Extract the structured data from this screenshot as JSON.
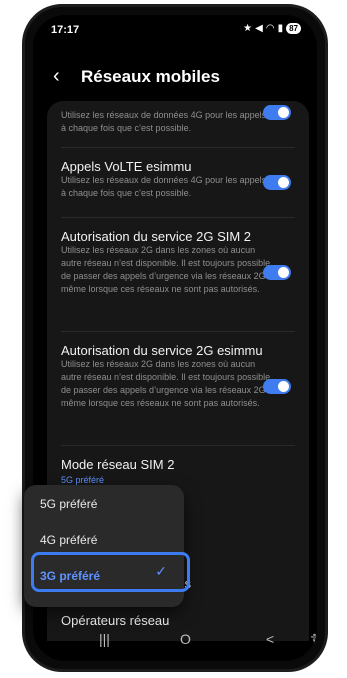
{
  "status": {
    "time": "17:17",
    "battery": "87"
  },
  "header": {
    "title": "Réseaux mobiles"
  },
  "items": {
    "top_desc": "Utilisez les réseaux de données 4G pour les appels à chaque fois que c’est possible.",
    "volte": {
      "title": "Appels VoLTE esimmu",
      "desc": "Utilisez les réseaux de données 4G pour les appels à chaque fois que c’est possible."
    },
    "sim2_2g": {
      "title": "Autorisation du service 2G SIM 2",
      "desc": "Utilisez les réseaux 2G dans les zones où aucun autre réseau n’est disponible. Il est toujours possible de passer des appels d’urgence via les réseaux 2G même lorsque ces réseaux ne sont pas autorisés."
    },
    "esimmu_2g": {
      "title": "Autorisation du service 2G esimmu",
      "desc": "Utilisez les réseaux 2G dans les zones où aucun autre réseau n’est disponible. Il est toujours possible de passer des appels d’urgence via les réseaux 2G même lorsque ces réseaux ne sont pas autorisés."
    },
    "mode_sim2": {
      "title": "Mode réseau SIM 2",
      "value": "5G préféré"
    },
    "hidden_partial": "s",
    "operators": {
      "title": "Opérateurs réseau"
    }
  },
  "dropdown": {
    "options": [
      "5G préféré",
      "4G préféré",
      "3G préféré"
    ],
    "selected": "3G préféré"
  },
  "navbar": {
    "recent": "|||",
    "home": "O",
    "back": "<",
    "accessibility": "☦"
  },
  "colors": {
    "accent": "#3e7cf0",
    "link": "#5f93ff",
    "background": "#000000",
    "card": "#171717"
  }
}
